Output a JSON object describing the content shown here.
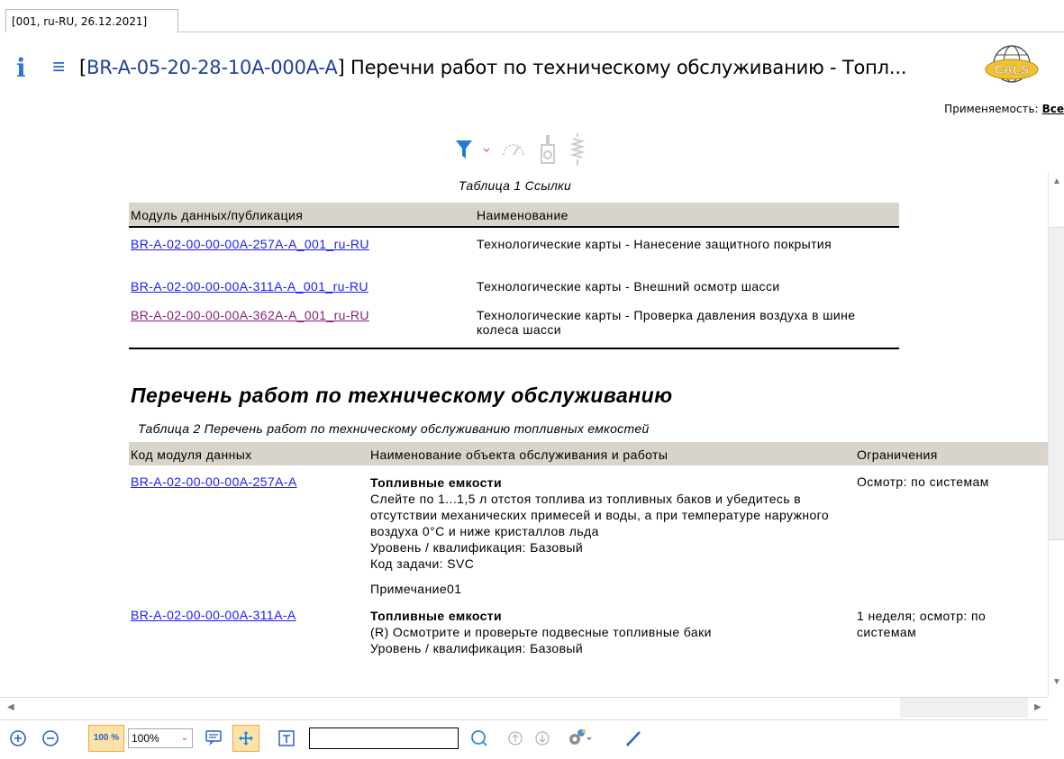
{
  "tab": {
    "label": "[001, ru-RU, 26.12.2021]"
  },
  "header": {
    "code": "BR-A-05-20-28-10A-000A-A",
    "title_rest": " Перечни работ по техническому обслуживанию - Топл...",
    "bracket_open": "[",
    "bracket_close": "]"
  },
  "applicability": {
    "label": "Применяемость:",
    "value": "Все"
  },
  "table1": {
    "caption": "Таблица 1   Ссылки",
    "headers": [
      "Модуль данных/публикация",
      "Наименование"
    ],
    "rows": [
      {
        "module": "BR-A-02-00-00-00A-257A-A_001_ru-RU",
        "name": "Технологические карты - Нанесение защитного покрытия"
      },
      {
        "module": "BR-A-02-00-00-00A-311A-A_001_ru-RU",
        "name": "Технологические карты - Внешний осмотр шасси"
      },
      {
        "module": "BR-A-02-00-00-00A-362A-A_001_ru-RU",
        "name": "Технологические карты - Проверка давления воздуха в шине колеса шасси"
      }
    ]
  },
  "section": {
    "title": "Перечень работ по техническому обслуживанию"
  },
  "table2": {
    "caption": "Таблица 2   Перечень работ по техническому обслуживанию топливных емкостей",
    "headers": [
      "Код модуля данных",
      "Наименование объекта обслуживания и работы",
      "Ограничения"
    ],
    "rows": [
      {
        "code": "BR-A-02-00-00-00A-257A-A",
        "object": "Топливные емкости",
        "desc": "Слейте по 1...1,5 л отстоя топлива из топливных баков и убедитесь в отсутствии механических примесей и воды, а при температуре наружного воздуха 0°С и ниже кристаллов льда",
        "level": "Уровень / квалификация: Базовый",
        "task": "Код задачи: SVC",
        "note": "Примечание01",
        "limit": "Осмотр: по системам"
      },
      {
        "code": "BR-A-02-00-00-00A-311A-A",
        "object": "Топливные емкости",
        "desc": "(R) Осмотрите и проверьте подвесные топливные баки",
        "level": "Уровень / квалификация: Базовый",
        "limit": "1 неделя; осмотр: по системам"
      }
    ]
  },
  "toolbar": {
    "zoom": "100%",
    "zoom_button": "100 %",
    "search_value": ""
  },
  "colors": {
    "accent": "#2a75d6",
    "table_header": "#d8d4cc",
    "link": "#1a1aff",
    "visited_link": "#8b1f7a"
  }
}
